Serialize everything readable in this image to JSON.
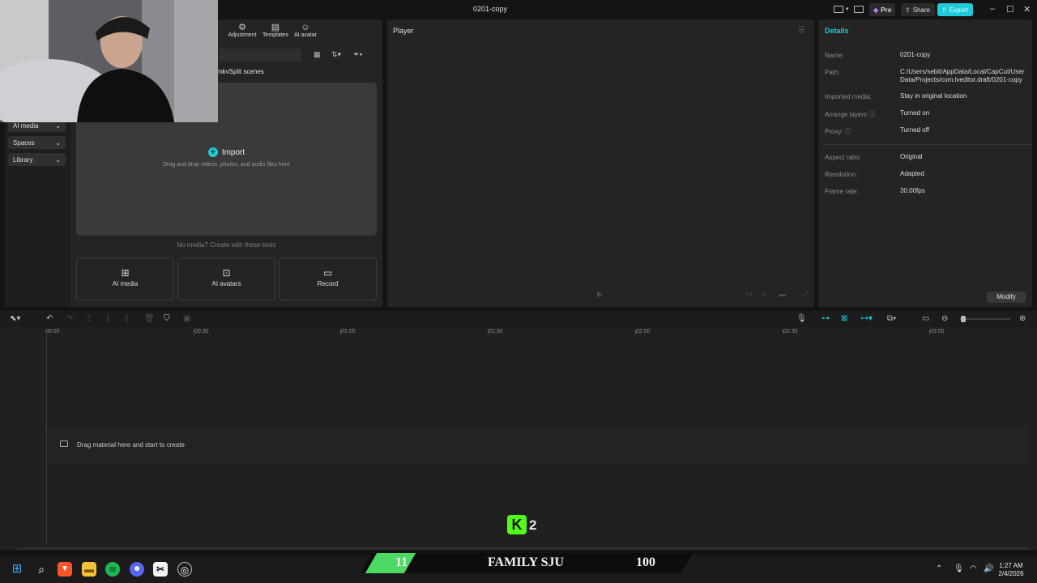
{
  "window": {
    "title": "0201-copy",
    "pro": "Pro",
    "share": "Share",
    "export": "Export"
  },
  "media_tabs": [
    {
      "label": "Adjustment",
      "icon": "sliders-icon"
    },
    {
      "label": "Templates",
      "icon": "templates-icon"
    },
    {
      "label": "AI avatar",
      "icon": "ai-avatar-icon"
    }
  ],
  "sidebar": {
    "items": [
      "AI media",
      "Spaces",
      "Library"
    ]
  },
  "media": {
    "split_label": "mkvSplit scenes",
    "import_label": "Import",
    "import_hint": "Drag and drop videos, photos, and audio files here",
    "no_media": "No media? Create with these tools",
    "tools": [
      "AI media",
      "AI avatars",
      "Record"
    ]
  },
  "player": {
    "title": "Player"
  },
  "details": {
    "title": "Details",
    "rows": [
      {
        "label": "Name:",
        "value": "0201-copy"
      },
      {
        "label": "Path:",
        "value": "C:/Users/sebit/AppData/Local/CapCut/User Data/Projects/com.lveditor.draft/0201-copy"
      },
      {
        "label": "Imported media:",
        "value": "Stay in original location"
      },
      {
        "label": "Arrange layers",
        "value": "Turned on"
      },
      {
        "label": "Proxy:",
        "value": "Turned off"
      },
      {
        "label": "Aspect ratio:",
        "value": "Original"
      },
      {
        "label": "Resolution:",
        "value": "Adapted"
      },
      {
        "label": "Frame rate:",
        "value": "30.00fps"
      }
    ],
    "modify": "Modify"
  },
  "timeline": {
    "ruler": [
      "00:00",
      "00:30",
      "01:00",
      "01:30",
      "02:00",
      "02:30",
      "03:00"
    ],
    "drop_hint": "Drag material here and start to create"
  },
  "overlay": {
    "kick_count": "2",
    "score_left": "11",
    "team": "FAMILY SJU",
    "score_right": "100"
  },
  "taskbar": {
    "time": "1:27 AM",
    "date": "2/4/2026"
  },
  "colors": {
    "accent": "#1fcadb",
    "kick": "#53fc18"
  }
}
